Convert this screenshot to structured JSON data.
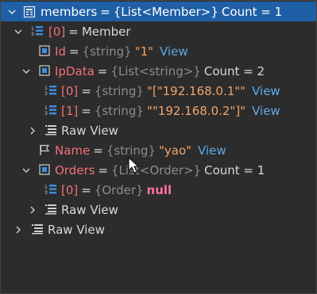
{
  "rows": [
    {
      "label_name": "members",
      "type": "{List<Member>}",
      "value": "Count = 1"
    },
    {
      "label_name": "[0]",
      "value": "Member"
    },
    {
      "label_name": "Id",
      "type": "{string}",
      "value": "\"1\"",
      "link": "View"
    },
    {
      "label_name": "IpData",
      "type": "{List<string>}",
      "value": "Count = 2"
    },
    {
      "label_name": "[0]",
      "type": "{string}",
      "value": "\"[\"192.168.0.1\"\"",
      "link": "View"
    },
    {
      "label_name": "[1]",
      "type": "{string}",
      "value": "\"\"192.168.0.2\"]\"",
      "link": "View"
    },
    {
      "label_name": "Raw View"
    },
    {
      "label_name": "Name",
      "type": "{string}",
      "value": "\"yao\"",
      "link": "View"
    },
    {
      "label_name": "Orders",
      "type": "{List<Order>}",
      "value": "Count = 1"
    },
    {
      "label_name": "[0]",
      "type": "{Order}",
      "value": "null"
    },
    {
      "label_name": "Raw View"
    },
    {
      "label_name": "Raw View"
    }
  ],
  "eq": "=",
  "icons": {
    "collection": "list-icon",
    "field": "field-icon",
    "property": "property-icon",
    "raw": "raw-view-icon",
    "flag": "flag-icon"
  },
  "colors": {
    "selected_bg": "#1f5fa6",
    "name": "#f07178",
    "string_value": "#f2a36a",
    "link": "#5fa9e8",
    "null": "#ff6f9f",
    "type": "#8c8c8c"
  }
}
